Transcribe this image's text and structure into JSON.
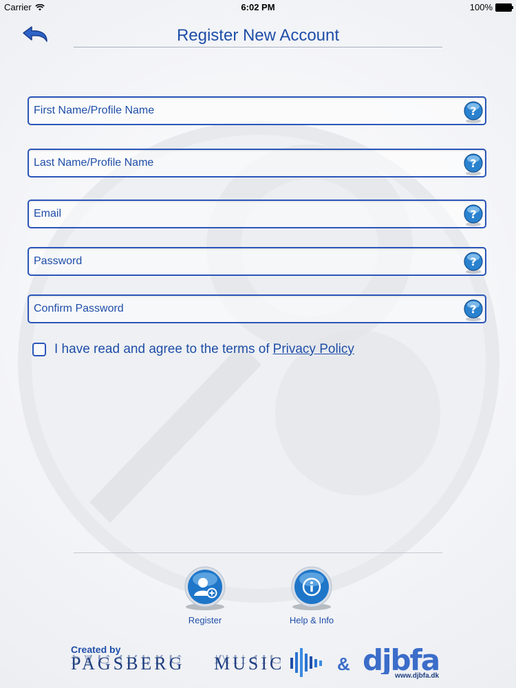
{
  "status_bar": {
    "carrier": "Carrier",
    "time": "6:02 PM",
    "battery": "100%"
  },
  "header": {
    "title": "Register New Account"
  },
  "form": {
    "fields": [
      {
        "placeholder": "First Name/Profile Name",
        "value": ""
      },
      {
        "placeholder": "Last Name/Profile Name",
        "value": ""
      },
      {
        "placeholder": "Email",
        "value": ""
      },
      {
        "placeholder": "Password",
        "value": ""
      },
      {
        "placeholder": "Confirm Password",
        "value": ""
      }
    ],
    "terms_text": "I have read and agree to the terms of",
    "privacy_link": "Privacy Policy",
    "terms_checked": false
  },
  "actions": {
    "register_label": "Register",
    "help_label": "Help & Info"
  },
  "footer": {
    "created_by": "Created by",
    "brand_left": "PAGSBERG",
    "brand_music": "MUSIC",
    "ampersand": "&",
    "brand_right": "djbfa",
    "brand_url": "www.djbfa.dk"
  },
  "colors": {
    "accent": "#1f4ea8",
    "border": "#2a56b9",
    "icon_blue": "#1a7fd6",
    "background": "#f4f5f8"
  },
  "icons": {
    "back": "back-arrow-icon",
    "help": "question-mark-icon",
    "register": "add-user-icon",
    "info": "info-icon"
  }
}
